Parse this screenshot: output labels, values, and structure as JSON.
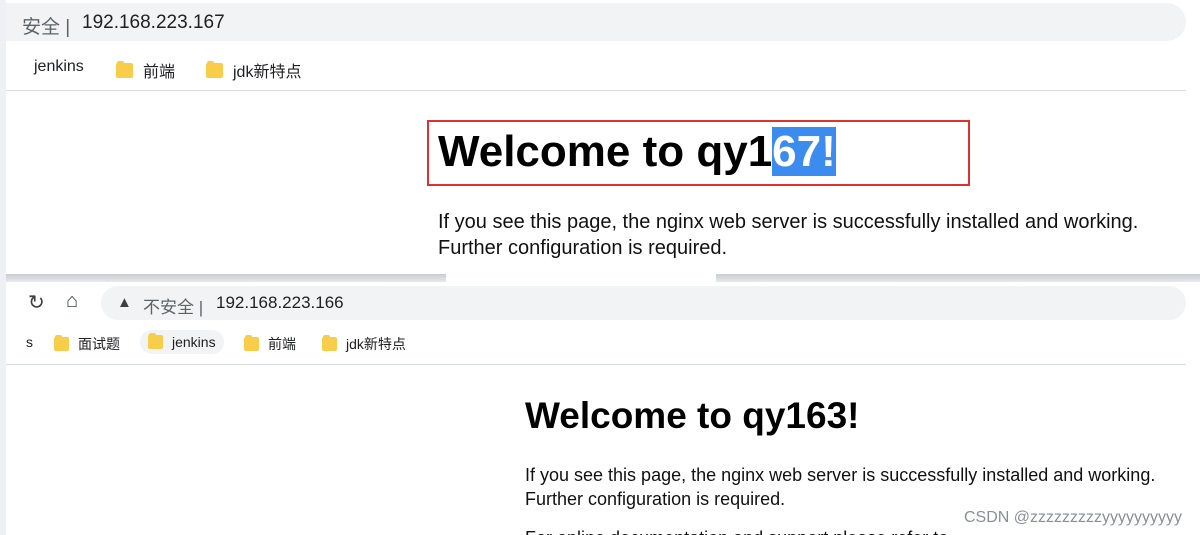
{
  "top_window": {
    "security_label": "安全 |",
    "url": "192.168.223.167",
    "bookmarks": [
      "jenkins",
      "前端",
      "jdk新特点"
    ],
    "heading_prefix": "Welcome to qy1",
    "heading_selected": "67!",
    "body_text": "If you see this page, the nginx web server is successfully installed and working. Further configuration is required."
  },
  "bottom_window": {
    "back_icon": "reload-icon",
    "home_icon": "home-icon",
    "warning_icon": "warning-icon",
    "security_label": "不安全 |",
    "url": "192.168.223.166",
    "bookmarks": [
      "s",
      "面试题",
      "jenkins",
      "前端",
      "jdk新特点"
    ],
    "heading": "Welcome to qy163!",
    "body_text": "If you see this page, the nginx web server is successfully installed and working. Further configuration is required.",
    "body_text_2": "For online documentation and support please refer to"
  },
  "watermark": "CSDN @zzzzzzzzzyyyyyyyyyy",
  "colors": {
    "highlight_box": "#e0312e",
    "selection": "#3c8cf0",
    "folder": "#f8cd4a",
    "omnibox": "#f1f3f4"
  }
}
